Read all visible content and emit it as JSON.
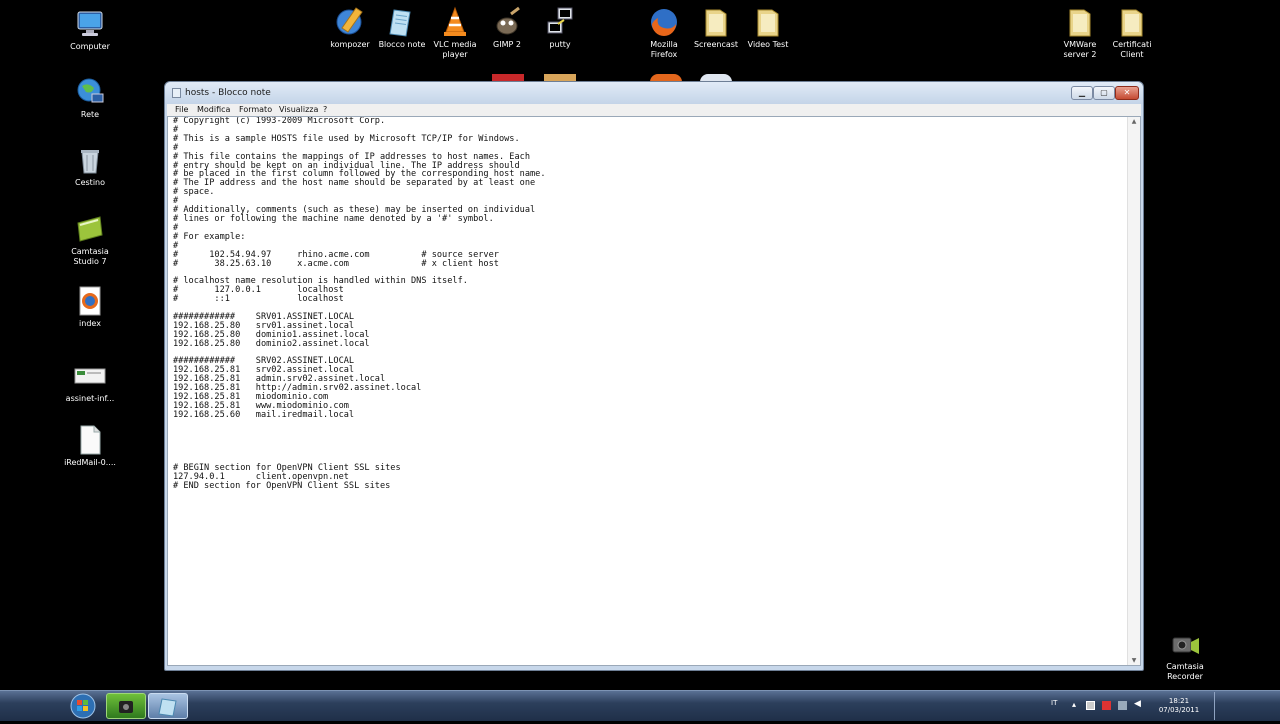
{
  "desktop": {
    "icons_left": [
      {
        "label": "Computer"
      },
      {
        "label": "Rete"
      },
      {
        "label": "Cestino"
      },
      {
        "label": "Camtasia\nStudio 7"
      },
      {
        "label": "index"
      },
      {
        "label": "assinet-inf..."
      },
      {
        "label": "iRedMail-0...."
      }
    ],
    "icons_top": [
      {
        "label": "kompozer"
      },
      {
        "label": "Blocco note"
      },
      {
        "label": "VLC media\nplayer"
      },
      {
        "label": "GIMP 2"
      },
      {
        "label": "putty"
      },
      {
        "label": "Mozilla\nFirefox"
      },
      {
        "label": "Screencast"
      },
      {
        "label": "Video Test"
      },
      {
        "label": "VMWare\nserver 2"
      },
      {
        "label": "Certificati\nClient"
      }
    ],
    "icons_right": [
      {
        "label": "Camtasia\nRecorder"
      }
    ]
  },
  "window": {
    "title": "hosts - Blocco note",
    "menu": [
      "File",
      "Modifica",
      "Formato",
      "Visualizza",
      "?"
    ],
    "content": "# Copyright (c) 1993-2009 Microsoft Corp.\n#\n# This is a sample HOSTS file used by Microsoft TCP/IP for Windows.\n#\n# This file contains the mappings of IP addresses to host names. Each\n# entry should be kept on an individual line. The IP address should\n# be placed in the first column followed by the corresponding host name.\n# The IP address and the host name should be separated by at least one\n# space.\n#\n# Additionally, comments (such as these) may be inserted on individual\n# lines or following the machine name denoted by a '#' symbol.\n#\n# For example:\n#\n#      102.54.94.97     rhino.acme.com          # source server\n#       38.25.63.10     x.acme.com              # x client host\n\n# localhost name resolution is handled within DNS itself.\n#\t127.0.0.1       localhost\n#\t::1             localhost\n\n############    SRV01.ASSINET.LOCAL\n192.168.25.80   srv01.assinet.local\n192.168.25.80   dominio1.assinet.local\n192.168.25.80   dominio2.assinet.local\n\n############    SRV02.ASSINET.LOCAL\n192.168.25.81   srv02.assinet.local\n192.168.25.81   admin.srv02.assinet.local\n192.168.25.81   http://admin.srv02.assinet.local\n192.168.25.81   miodominio.com\n192.168.25.81   www.miodominio.com\n192.168.25.60   mail.iredmail.local\n\n\n\n\n\n# BEGIN section for OpenVPN Client SSL sites\n127.94.0.1      client.openvpn.net\n# END section for OpenVPN Client SSL sites"
  },
  "taskbar": {
    "language": "IT",
    "time": "18:21",
    "date": "07/03/2011"
  }
}
